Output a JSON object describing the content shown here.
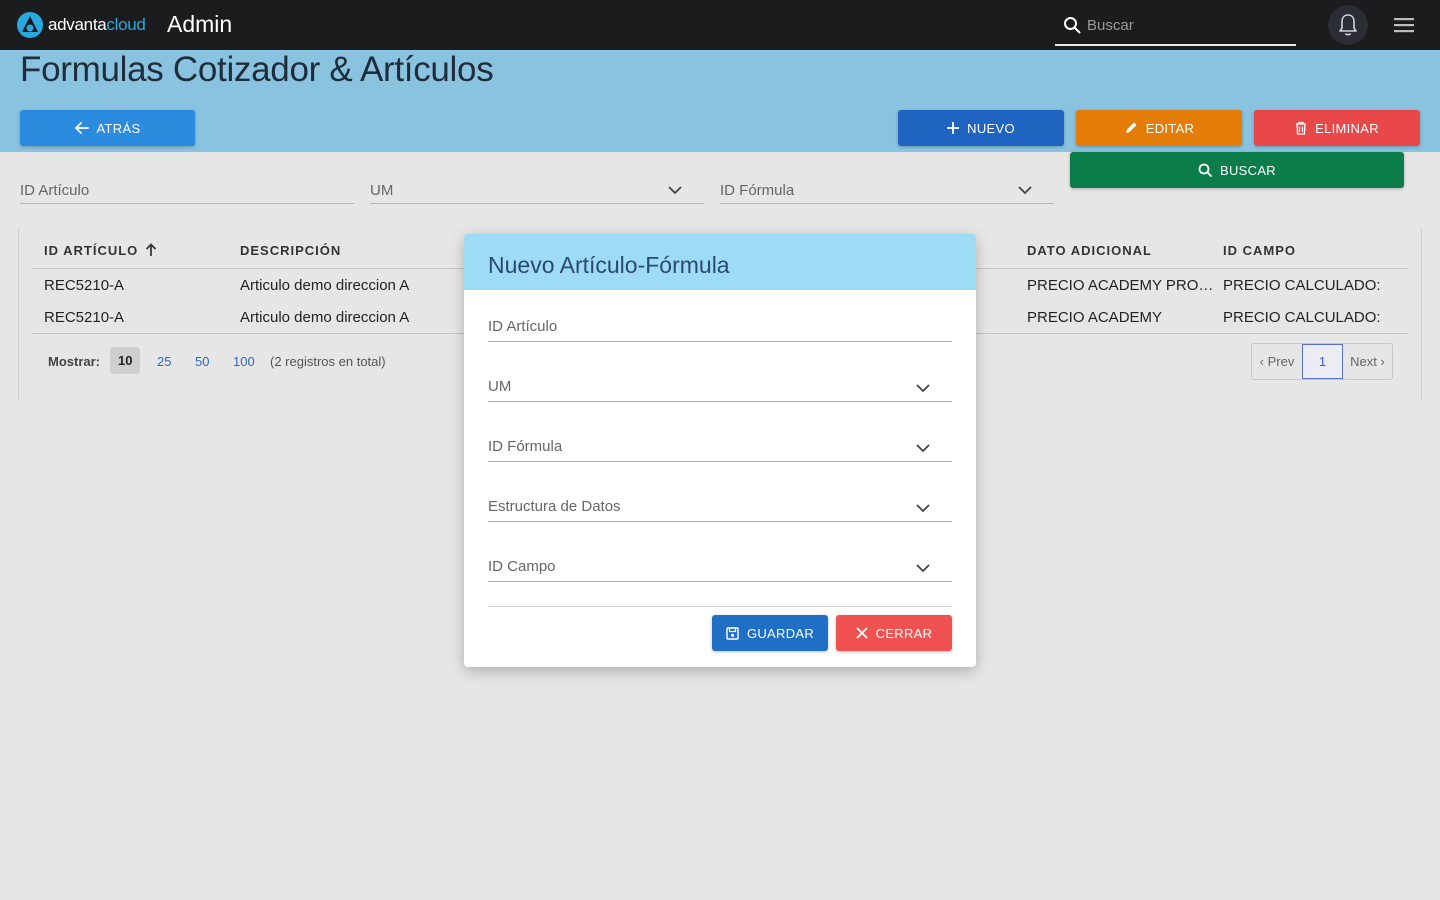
{
  "topbar": {
    "logo_word_1": "advanta",
    "logo_word_2": "cloud",
    "title": "Admin",
    "search_placeholder": "Buscar",
    "icons": [
      "search-icon",
      "bell-icon",
      "hamburger-menu-icon"
    ]
  },
  "header": {
    "title": "Formulas Cotizador & Artículos",
    "back_label": "ATRÁS",
    "new_label": "NUEVO",
    "edit_label": "EDITAR",
    "delete_label": "ELIMINAR",
    "search_label": "BUSCAR"
  },
  "filters": {
    "id_articulo": "ID Artículo",
    "um": "UM",
    "id_formula": "ID Fórmula"
  },
  "table": {
    "columns": [
      "ID ARTÍCULO",
      "DESCRIPCIÓN",
      "DATO ADICIONAL",
      "ID CAMPO"
    ],
    "sorted_column": "ID ARTÍCULO",
    "rows": [
      {
        "id_articulo": "REC5210-A",
        "descripcion": "Articulo demo direccion A",
        "dato_adicional": "PRECIO ACADEMY PRO…",
        "id_campo": "PRECIO CALCULADO:"
      },
      {
        "id_articulo": "REC5210-A",
        "descripcion": "Articulo demo direccion A",
        "dato_adicional": "PRECIO ACADEMY",
        "id_campo": "PRECIO CALCULADO:"
      }
    ]
  },
  "pagination": {
    "show_label": "Mostrar:",
    "sizes": [
      "10",
      "25",
      "50",
      "100"
    ],
    "active_size": "10",
    "total_text": "(2 registros en total)",
    "prev_label": "‹ Prev",
    "current_page": "1",
    "next_label": "Next ›"
  },
  "modal": {
    "title": "Nuevo Artículo-Fórmula",
    "fields": {
      "id_articulo": "ID Artículo",
      "um": "UM",
      "id_formula": "ID Fórmula",
      "estructura": "Estructura de Datos",
      "id_campo": "ID Campo"
    },
    "save_label": "GUARDAR",
    "close_label": "CERRAR"
  },
  "colors": {
    "topbar": "#1b1c1d",
    "header_band": "#89c3e0",
    "back": "#2a8bdf",
    "new": "#1f64c1",
    "edit": "#e37d07",
    "delete": "#e84848",
    "search": "#0b7d4b",
    "modal_header": "#9edbf4",
    "save": "#1f6fc6",
    "close": "#f05252"
  }
}
